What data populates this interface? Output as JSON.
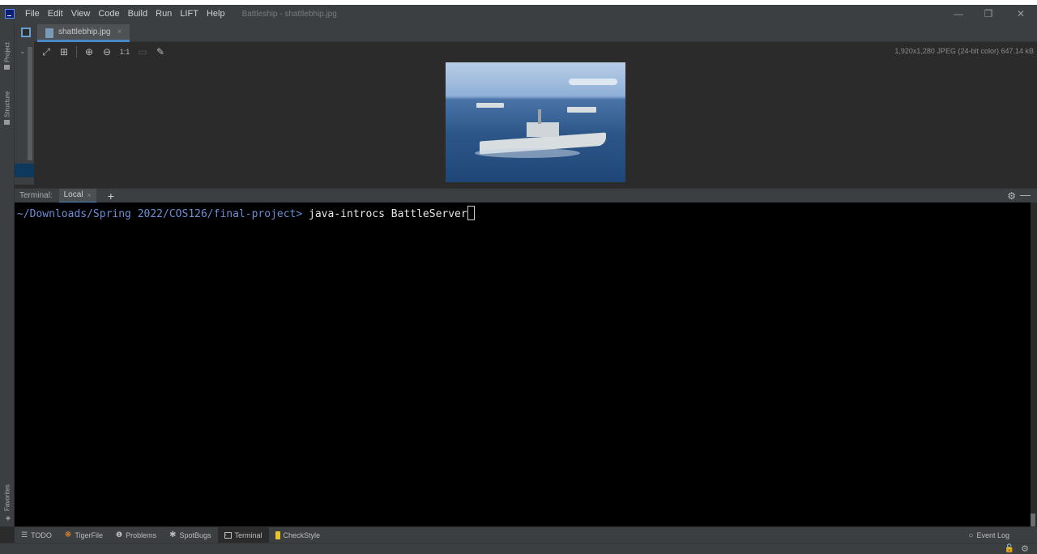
{
  "menu": [
    "File",
    "Edit",
    "View",
    "Code",
    "Build",
    "Run",
    "LIFT",
    "Help"
  ],
  "window_title": "Battleship - shattlebhip.jpg",
  "window_controls": {
    "minimize": "—",
    "restore": "❐",
    "close": "✕"
  },
  "left_stripe": {
    "project": "Project",
    "structure": "Structure",
    "favorites": "Favorites"
  },
  "editor": {
    "tab_label": "shattlebhip.jpg",
    "tab_close": "×",
    "toolbar": {
      "fit_icon": "⤢",
      "grid_icon": "⊞",
      "zoom_in_icon": "⊕",
      "zoom_out_icon": "⊖",
      "actual_size": "1:1",
      "background_icon": "▭",
      "color_picker_icon": "✎"
    },
    "image_info": "1,920x1,280 JPEG (24-bit color) 647.14 kB"
  },
  "terminal": {
    "title": "Terminal:",
    "tab": "Local",
    "tab_close": "×",
    "add": "+",
    "gear": "⚙",
    "minimize": "—",
    "prompt_path": "~/Downloads/Spring 2022/COS126/final-project>",
    "command": " java-introcs BattleServer"
  },
  "bottom_bar": {
    "items": [
      {
        "label": "TODO",
        "icon": "list-icon",
        "color": "#bbbbbb"
      },
      {
        "label": "TigerFile",
        "icon": "paw-icon",
        "color": "#e8872c"
      },
      {
        "label": "Problems",
        "icon": "info-icon",
        "color": "#bbbbbb"
      },
      {
        "label": "SpotBugs",
        "icon": "bug-icon",
        "color": "#bbbbbb"
      },
      {
        "label": "Terminal",
        "icon": "terminal-icon",
        "color": "#bbbbbb"
      },
      {
        "label": "CheckStyle",
        "icon": "checkstyle-icon",
        "color": "#e8c42c"
      }
    ],
    "event_log": "Event Log"
  },
  "status_bar": {
    "lock": "🔓",
    "gear": "⚙"
  }
}
